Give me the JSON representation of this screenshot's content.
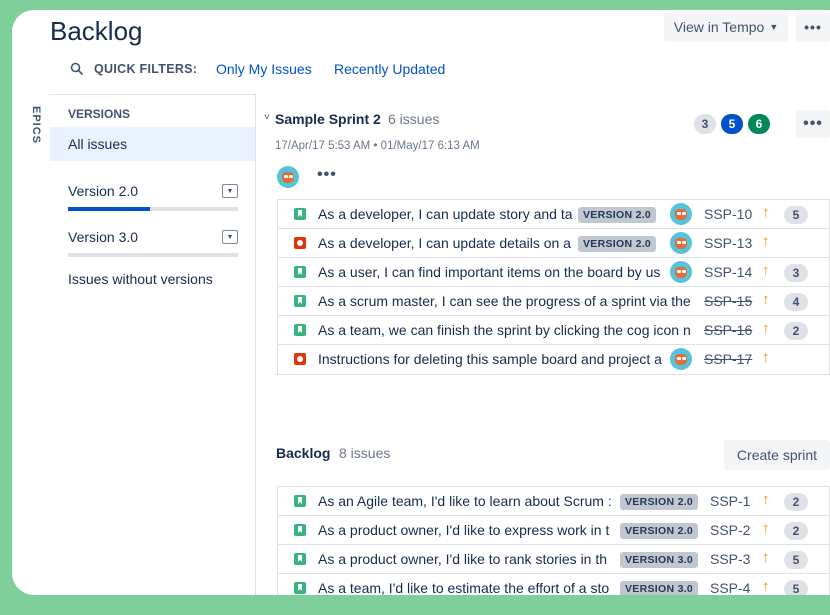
{
  "colors": {
    "outer_background": "#7fcf9a",
    "link": "#0052cc",
    "selected_item": "#ebf2ff",
    "story_icon": "#36b37e",
    "bug_icon": "#de350b",
    "priority_high": "#ff8b00",
    "count_todo": "#dfe1e6",
    "count_in_progress": "#0052cc",
    "count_done": "#00875a"
  },
  "header": {
    "title": "Backlog",
    "view_in_tempo": "View in Tempo",
    "more_label": "•••"
  },
  "quick_filters": {
    "label": "QUICK FILTERS:",
    "filters": [
      "Only My Issues",
      "Recently Updated"
    ]
  },
  "epics_tab": "EPICS",
  "sidebar": {
    "heading": "VERSIONS",
    "all_issues": "All issues",
    "versions": [
      {
        "label": "Version 2.0",
        "progress": 0.48
      },
      {
        "label": "Version 3.0",
        "progress": 0.0
      }
    ],
    "without_versions": "Issues without versions"
  },
  "sprint": {
    "name": "Sample Sprint 2",
    "count": "6 issues",
    "dates": "17/Apr/17 5:53 AM • 01/May/17 6:13 AM",
    "status_counts": [
      "3",
      "5",
      "6"
    ],
    "more_label": "•••",
    "assignee_more": "•••",
    "issues": [
      {
        "type": "story",
        "summary": "As a developer, I can update story and ta",
        "version": "VERSION 2.0",
        "avatar": true,
        "key": "SSP-10",
        "done": false,
        "priority": "↑",
        "estimate": "5"
      },
      {
        "type": "bug",
        "summary": "As a developer, I can update details on a",
        "version": "VERSION 2.0",
        "avatar": true,
        "key": "SSP-13",
        "done": false,
        "priority": "↑",
        "estimate": ""
      },
      {
        "type": "story",
        "summary": "As a user, I can find important items on the board by us",
        "version": "",
        "avatar": true,
        "key": "SSP-14",
        "done": false,
        "priority": "↑",
        "estimate": "3"
      },
      {
        "type": "story",
        "summary": "As a scrum master, I can see the progress of a sprint via the",
        "version": "",
        "avatar": false,
        "key": "SSP-15",
        "done": true,
        "priority": "↑",
        "estimate": "4"
      },
      {
        "type": "story",
        "summary": "As a team, we can finish the sprint by clicking the cog icon n",
        "version": "",
        "avatar": false,
        "key": "SSP-16",
        "done": true,
        "priority": "↑",
        "estimate": "2"
      },
      {
        "type": "bug",
        "summary": "Instructions for deleting this sample board and project a",
        "version": "",
        "avatar": true,
        "key": "SSP-17",
        "done": true,
        "priority": "↑",
        "estimate": ""
      }
    ]
  },
  "backlog": {
    "name": "Backlog",
    "count": "8 issues",
    "create_sprint": "Create sprint",
    "issues": [
      {
        "type": "story",
        "summary": "As an Agile team, I'd like to learn about Scrum :",
        "version": "VERSION 2.0",
        "key": "SSP-1",
        "priority": "↑",
        "estimate": "2"
      },
      {
        "type": "story",
        "summary": "As a product owner, I'd like to express work in t",
        "version": "VERSION 2.0",
        "key": "SSP-2",
        "priority": "↑",
        "estimate": "2"
      },
      {
        "type": "story",
        "summary": "As a product owner, I'd like to rank stories in th",
        "version": "VERSION 3.0",
        "key": "SSP-3",
        "priority": "↑",
        "estimate": "5"
      },
      {
        "type": "story",
        "summary": "As a team, I'd like to estimate the effort of a sto",
        "version": "VERSION 3.0",
        "key": "SSP-4",
        "priority": "↑",
        "estimate": "5"
      }
    ]
  }
}
